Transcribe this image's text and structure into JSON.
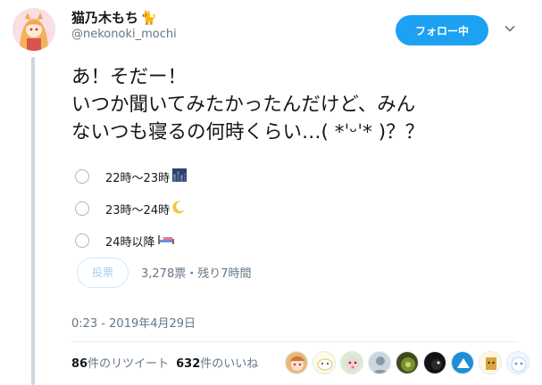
{
  "user": {
    "display_name": "猫乃木もち",
    "name_emoji": "🐈",
    "handle": "@nekonoki_mochi"
  },
  "follow_button_label": "フォロー中",
  "tweet_text": "あ！そだー！\nいつか聞いてみたかったんだけど、みん\nないつも寝るの何時くらい…( *ˈᵕˈ* )？？",
  "poll": {
    "options": [
      {
        "label": "22時〜23時",
        "icon": "night-city-icon"
      },
      {
        "label": "23時〜24時",
        "icon": "crescent-moon-icon"
      },
      {
        "label": "24時以降",
        "icon": "bed-icon"
      }
    ],
    "vote_label": "投票",
    "meta": "3,278票・残り7時間"
  },
  "timestamp": "0:23 - 2019年4月29日",
  "stats": {
    "retweets_count": "86",
    "retweets_label": "件のリツイート",
    "likes_count": "632",
    "likes_label": "件のいいね"
  },
  "colors": {
    "accent": "#1da1f2",
    "muted": "#657786",
    "thread_line": "#ccd6dd"
  },
  "liker_avatars": [
    "liker-avatar-1",
    "liker-avatar-2",
    "liker-avatar-3",
    "liker-avatar-4",
    "liker-avatar-5",
    "liker-avatar-6",
    "liker-avatar-7",
    "liker-avatar-8",
    "liker-avatar-9"
  ]
}
